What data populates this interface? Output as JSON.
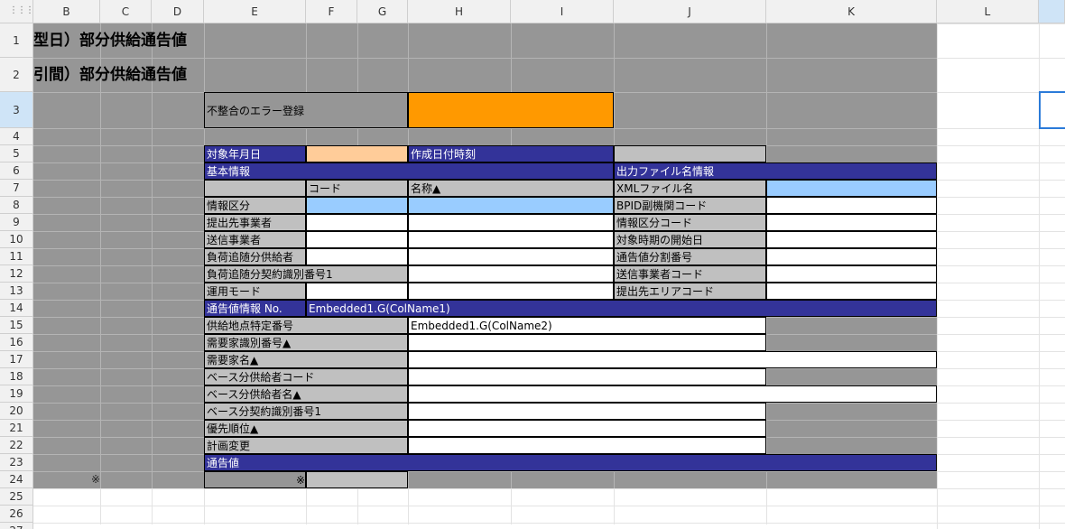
{
  "sheet": {
    "columns": [
      "B",
      "C",
      "D",
      "E",
      "F",
      "G",
      "H",
      "I",
      "J",
      "K",
      "L"
    ],
    "rows": [
      "1",
      "2",
      "3",
      "4",
      "5",
      "6",
      "7",
      "8",
      "9",
      "10",
      "11",
      "12",
      "13",
      "14",
      "15",
      "16",
      "17",
      "18",
      "19",
      "20",
      "21",
      "22",
      "23",
      "24",
      "25",
      "26",
      "27"
    ],
    "corner_icon": "⋮⋮⋮"
  },
  "colors": {
    "gray_fill": "#969696",
    "navy_header": "#333399",
    "orange": "#ff9900",
    "peach": "#ffcc99",
    "light_blue": "#99ccff",
    "label_gray": "#c0c0c0",
    "white": "#ffffff",
    "selection": "#2b7bd9"
  },
  "cells": {
    "title1": "型日）部分供給通告値",
    "title2": "引間）部分供給通告値",
    "error_reg": "不整合のエラー登録",
    "target_date": "対象年月日",
    "created_datetime": "作成日付時刻",
    "basic_info": "基本情報",
    "output_file_info": "出力ファイル名情報",
    "code": "コード",
    "name": "名称▲",
    "xml_file_name": "XMLファイル名",
    "info_kubun": "情報区分",
    "bpid_sub_code": "BPID副機関コード",
    "submit_to_company": "提出先事業者",
    "info_kubun_code": "情報区分コード",
    "sender_company": "送信事業者",
    "target_period_start": "対象時期の開始日",
    "load_follow_supplier": "負荷追随分供給者",
    "notice_split_no": "通告値分割番号",
    "load_follow_contract_id": "負荷追随分契約識別番号1",
    "sender_company_code": "送信事業者コード",
    "operation_mode": "運用モード",
    "submit_area_code": "提出先エリアコード",
    "notice_info_no": "通告値情報   No.",
    "embedded_col1": "Embedded1.G(ColName1)",
    "supply_point_id": "供給地点特定番号",
    "embedded_col2": "Embedded1.G(ColName2)",
    "consumer_id": "需要家識別番号▲",
    "consumer_name": "需要家名▲",
    "base_supplier_code": "ベース分供給者コード",
    "base_supplier_name": "ベース分供給者名▲",
    "base_contract_id": "ベース分契約識別番号1",
    "priority": "優先順位▲",
    "plan_change": "計画変更",
    "notice_value": "通告値",
    "note_mark_b24": "※",
    "note_mark_e24": "※"
  }
}
